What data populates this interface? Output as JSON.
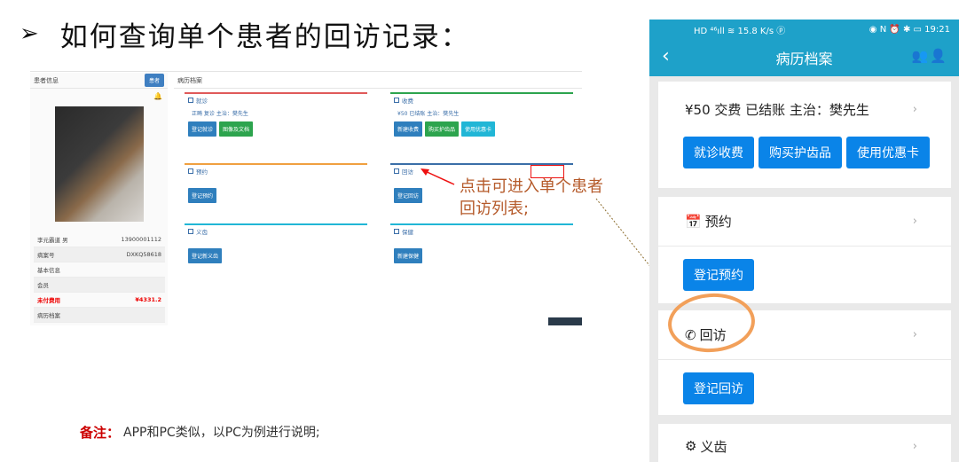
{
  "slide": {
    "title": "如何查询单个患者的回访记录：",
    "annotation": "点击可进入单个患者回访列表;",
    "note_label": "备注：",
    "note_text": "APP和PC类似，以PC为例进行说明;"
  },
  "pc": {
    "left_header": "患者信息",
    "left_header_btn": "患者",
    "patient_rows": [
      {
        "label": "李元霸道 男",
        "value": "13900001112"
      },
      {
        "label": "病案号",
        "value": "DXKQ58618"
      },
      {
        "label": "基本信息",
        "value": ""
      },
      {
        "label": "会员",
        "value": ""
      },
      {
        "label": "未付费用",
        "value": "¥4331.2"
      },
      {
        "label": "病历档案",
        "value": ""
      }
    ],
    "main_header": "病历档案",
    "cards": {
      "visit": {
        "title": "就诊",
        "line": "正畸 复诊 主治：樊先生",
        "buttons": [
          "登记就诊",
          "图像及文档"
        ]
      },
      "fee": {
        "title": "收费",
        "line": "¥50 已结账 主治：樊先生",
        "buttons": [
          "新建收费",
          "购买护齿品",
          "使用优惠卡"
        ]
      },
      "appt": {
        "title": "预约",
        "buttons": [
          "登记预约"
        ]
      },
      "followup": {
        "title": "回访",
        "buttons": [
          "登记回访"
        ]
      },
      "tooth": {
        "title": "义齿",
        "buttons": [
          "登记新义齿"
        ]
      },
      "insurance": {
        "title": "保健",
        "buttons": [
          "新建保健"
        ]
      }
    }
  },
  "phone": {
    "status_left": "HD ⁴⁶ıll ≋ 15.8 K/s ⓟ",
    "status_right": "◉ N ⏰ ✱ ▭ 19:21",
    "nav_title": "病历档案",
    "fee_line": "¥50 交费 已结账 主治：樊先生",
    "fee_buttons": [
      "就诊收费",
      "购买护齿品",
      "使用优惠卡"
    ],
    "appt_title": "预约",
    "appt_button": "登记预约",
    "followup_title": "回访",
    "followup_button": "登记回访",
    "tooth_title": "义齿"
  },
  "colors": {
    "nav": "#1ea1c9",
    "button": "#0a84e8",
    "highlight": "#f2a05a",
    "callout": "#b55a2a"
  }
}
